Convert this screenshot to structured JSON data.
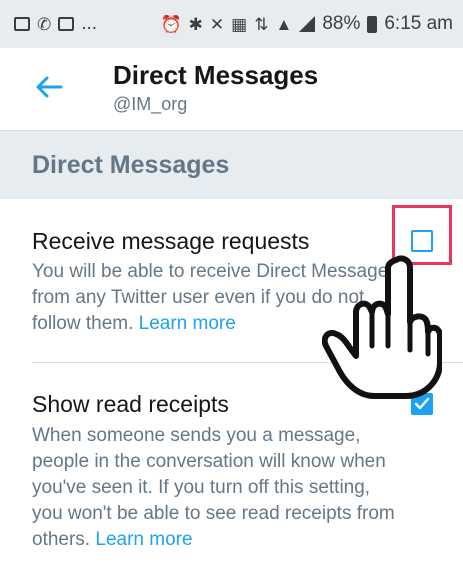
{
  "status_bar": {
    "left_more": "...",
    "battery_percent": "88%",
    "time": "6:15 am"
  },
  "header": {
    "title": "Direct Messages",
    "subtitle": "@IM_org"
  },
  "section": {
    "title": "Direct Messages"
  },
  "settings": [
    {
      "title": "Receive message requests",
      "description": "You will be able to receive Direct Messages from any Twitter user even if you do not follow them.",
      "link": "Learn more",
      "checked": false
    },
    {
      "title": "Show read receipts",
      "description": "When someone sends you a message, people in the conversation will know when you've seen it. If you turn off this setting, you won't be able to see read receipts from others.",
      "link": "Learn more",
      "checked": true
    }
  ],
  "icons": {
    "back": "arrow-left-icon",
    "cursor": "hand-pointer-icon"
  },
  "colors": {
    "accent": "#1da1f2",
    "highlight": "#e8365f",
    "section_bg": "#e6ecf0",
    "status_bar_bg": "#e9ecef"
  }
}
